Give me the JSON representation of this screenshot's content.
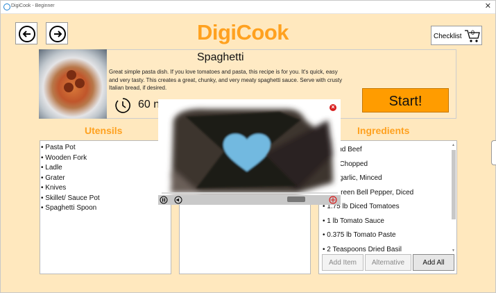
{
  "window": {
    "title": "DigiCook - Beginner",
    "close_glyph": "✕"
  },
  "app": {
    "logo": "DigiCook"
  },
  "nav": {
    "back_icon": "arrow-left-icon",
    "forward_icon": "arrow-right-icon"
  },
  "checklist": {
    "label": "Checklist",
    "count": "0",
    "icon": "cart-icon"
  },
  "recipe": {
    "title": "Spaghetti",
    "description": "Great simple pasta dish. If you love tomatoes and pasta, this recipe is for you. It's quick, easy and very tasty. This creates a great, chunky, and very meaty spaghetti sauce. Serve with crusty Italian bread, if desired.",
    "time": "60 n",
    "start_label": "Start!"
  },
  "sections": {
    "utensils": "Utensils",
    "ingredients": "Ingredients"
  },
  "utensils": [
    "• Pasta Pot",
    "• Wooden Fork",
    "• Ladle",
    "• Grater",
    "• Knives",
    "• Skillet/ Sauce Pot",
    "• Spaghetti Spoon"
  ],
  "ingredients": [
    "Ground Beef",
    "nion, Chopped",
    "oves garlic, Minced",
    "nall Green Bell Pepper, Diced",
    "• 1.75 lb Diced Tomatoes",
    "• 1 lb Tomato Sauce",
    "• 0.375 lb Tomato Paste",
    "• 2 Teaspoons Dried Basil"
  ],
  "buttons": {
    "add_item": "Add Item",
    "alternative": "Alternative",
    "add_all": "Add All"
  },
  "video": {
    "close_glyph": "×",
    "progress": 0.0
  },
  "colors": {
    "accent": "#ffa11f",
    "background": "#ffe8be",
    "start": "#ff9c00",
    "close": "#d81e1e",
    "heart": "#72b9e0"
  }
}
